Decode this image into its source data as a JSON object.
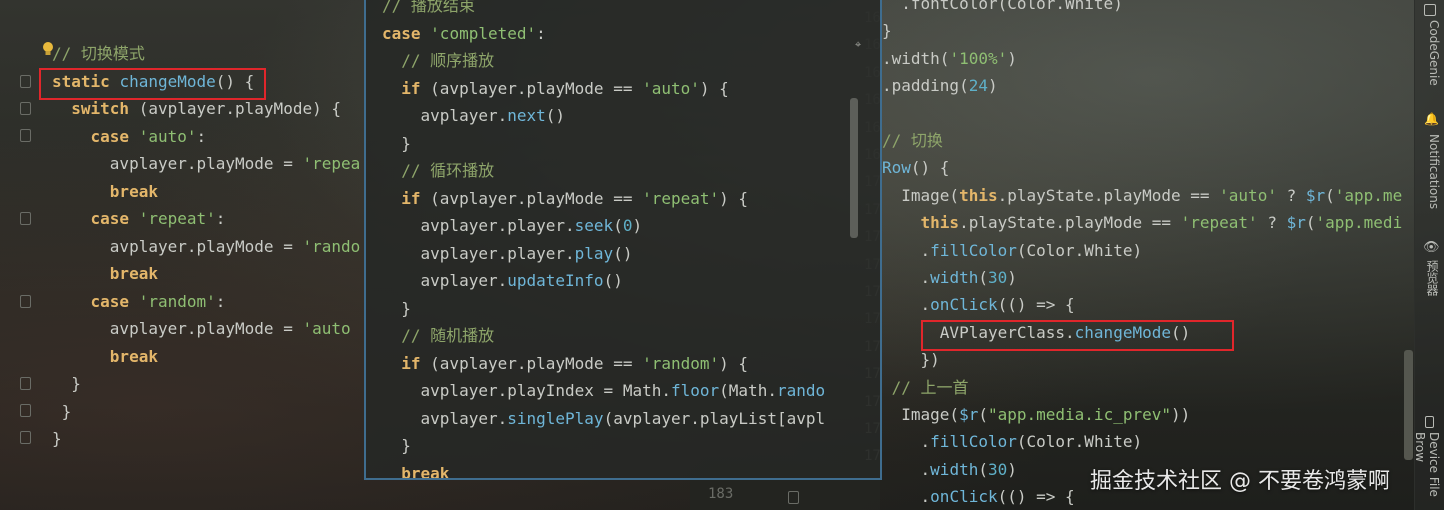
{
  "left_editor": {
    "lines": [
      {
        "segments": [
          {
            "t": "// 切换模式",
            "c": "cmt"
          }
        ]
      },
      {
        "segments": [
          {
            "t": "static",
            "c": "kw"
          },
          {
            "t": " ",
            "c": "pn"
          },
          {
            "t": "changeMode",
            "c": "fn"
          },
          {
            "t": "() {",
            "c": "pn"
          }
        ]
      },
      {
        "segments": [
          {
            "t": "  switch",
            "c": "kw"
          },
          {
            "t": " (avplayer.playMode) {",
            "c": "pn"
          }
        ]
      },
      {
        "segments": [
          {
            "t": "    case",
            "c": "kw"
          },
          {
            "t": " ",
            "c": "pn"
          },
          {
            "t": "'auto'",
            "c": "str"
          },
          {
            "t": ":",
            "c": "pn"
          }
        ]
      },
      {
        "segments": [
          {
            "t": "      avplayer.playMode = ",
            "c": "pn"
          },
          {
            "t": "'repea",
            "c": "str"
          }
        ]
      },
      {
        "segments": [
          {
            "t": "      break",
            "c": "kw"
          }
        ]
      },
      {
        "segments": [
          {
            "t": "    case",
            "c": "kw"
          },
          {
            "t": " ",
            "c": "pn"
          },
          {
            "t": "'repeat'",
            "c": "str"
          },
          {
            "t": ":",
            "c": "pn"
          }
        ]
      },
      {
        "segments": [
          {
            "t": "      avplayer.playMode = ",
            "c": "pn"
          },
          {
            "t": "'rando",
            "c": "str"
          }
        ]
      },
      {
        "segments": [
          {
            "t": "      break",
            "c": "kw"
          }
        ]
      },
      {
        "segments": [
          {
            "t": "    case",
            "c": "kw"
          },
          {
            "t": " ",
            "c": "pn"
          },
          {
            "t": "'random'",
            "c": "str"
          },
          {
            "t": ":",
            "c": "pn"
          }
        ]
      },
      {
        "segments": [
          {
            "t": "      avplayer.playMode = ",
            "c": "pn"
          },
          {
            "t": "'auto",
            "c": "str"
          }
        ]
      },
      {
        "segments": [
          {
            "t": "      break",
            "c": "kw"
          }
        ]
      },
      {
        "segments": [
          {
            "t": "  }",
            "c": "pn"
          }
        ]
      },
      {
        "segments": [
          {
            "t": " }",
            "c": "pn"
          }
        ]
      },
      {
        "segments": [
          {
            "t": "}",
            "c": "pn"
          }
        ]
      }
    ]
  },
  "popup": {
    "lines": [
      {
        "segments": [
          {
            "t": "// 播放结束",
            "c": "cmt"
          }
        ]
      },
      {
        "segments": [
          {
            "t": "case",
            "c": "kw"
          },
          {
            "t": " ",
            "c": "pn"
          },
          {
            "t": "'completed'",
            "c": "str"
          },
          {
            "t": ":",
            "c": "pn"
          }
        ]
      },
      {
        "segments": [
          {
            "t": "  // 顺序播放",
            "c": "cmt"
          }
        ]
      },
      {
        "segments": [
          {
            "t": "  if",
            "c": "kw"
          },
          {
            "t": " (avplayer.playMode == ",
            "c": "pn"
          },
          {
            "t": "'auto'",
            "c": "str"
          },
          {
            "t": ") {",
            "c": "pn"
          }
        ]
      },
      {
        "segments": [
          {
            "t": "    avplayer.",
            "c": "pn"
          },
          {
            "t": "next",
            "c": "fn"
          },
          {
            "t": "()",
            "c": "pn"
          }
        ]
      },
      {
        "segments": [
          {
            "t": "  }",
            "c": "pn"
          }
        ]
      },
      {
        "segments": [
          {
            "t": "  // 循环播放",
            "c": "cmt"
          }
        ]
      },
      {
        "segments": [
          {
            "t": "  if",
            "c": "kw"
          },
          {
            "t": " (avplayer.playMode == ",
            "c": "pn"
          },
          {
            "t": "'repeat'",
            "c": "str"
          },
          {
            "t": ") {",
            "c": "pn"
          }
        ]
      },
      {
        "segments": [
          {
            "t": "    avplayer.player.",
            "c": "pn"
          },
          {
            "t": "seek",
            "c": "fn"
          },
          {
            "t": "(",
            "c": "pn"
          },
          {
            "t": "0",
            "c": "num"
          },
          {
            "t": ")",
            "c": "pn"
          }
        ]
      },
      {
        "segments": [
          {
            "t": "    avplayer.player.",
            "c": "pn"
          },
          {
            "t": "play",
            "c": "fn"
          },
          {
            "t": "()",
            "c": "pn"
          }
        ]
      },
      {
        "segments": [
          {
            "t": "    avplayer.",
            "c": "pn"
          },
          {
            "t": "updateInfo",
            "c": "fn"
          },
          {
            "t": "()",
            "c": "pn"
          }
        ]
      },
      {
        "segments": [
          {
            "t": "  }",
            "c": "pn"
          }
        ]
      },
      {
        "segments": [
          {
            "t": "  // 随机播放",
            "c": "cmt"
          }
        ]
      },
      {
        "segments": [
          {
            "t": "  if",
            "c": "kw"
          },
          {
            "t": " (avplayer.playMode == ",
            "c": "pn"
          },
          {
            "t": "'random'",
            "c": "str"
          },
          {
            "t": ") {",
            "c": "pn"
          }
        ]
      },
      {
        "segments": [
          {
            "t": "    avplayer.playIndex = Math.",
            "c": "pn"
          },
          {
            "t": "floor",
            "c": "fn"
          },
          {
            "t": "(Math.",
            "c": "pn"
          },
          {
            "t": "rando",
            "c": "fn"
          }
        ]
      },
      {
        "segments": [
          {
            "t": "    avplayer.",
            "c": "pn"
          },
          {
            "t": "singlePlay",
            "c": "fn"
          },
          {
            "t": "(avplayer.playList[avpl",
            "c": "pn"
          }
        ]
      },
      {
        "segments": [
          {
            "t": "  }",
            "c": "pn"
          }
        ]
      },
      {
        "segments": [
          {
            "t": "  break",
            "c": "kw"
          }
        ]
      }
    ]
  },
  "right_editor": {
    "gutter": [
      "16",
      "16",
      "16",
      "16",
      "16",
      "16",
      "17",
      "17",
      "17",
      "17",
      "17",
      "17",
      "17",
      "17",
      "17",
      "17",
      "17"
    ],
    "lines": [
      {
        "segments": [
          {
            "t": "  .fontColor(Color.White)",
            "c": "pn"
          }
        ]
      },
      {
        "segments": [
          {
            "t": "}",
            "c": "pn"
          }
        ]
      },
      {
        "segments": [
          {
            "t": ".width(",
            "c": "pn"
          },
          {
            "t": "'100%'",
            "c": "str"
          },
          {
            "t": ")",
            "c": "pn"
          }
        ]
      },
      {
        "segments": [
          {
            "t": ".padding(",
            "c": "pn"
          },
          {
            "t": "24",
            "c": "num"
          },
          {
            "t": ")",
            "c": "pn"
          }
        ]
      },
      {
        "segments": [
          {
            "t": "",
            "c": "pn"
          }
        ]
      },
      {
        "segments": [
          {
            "t": "// 切换",
            "c": "cmt"
          }
        ]
      },
      {
        "segments": [
          {
            "t": "Row",
            "c": "fn"
          },
          {
            "t": "() {",
            "c": "pn"
          }
        ]
      },
      {
        "segments": [
          {
            "t": "  Image(",
            "c": "pn"
          },
          {
            "t": "this",
            "c": "thisk"
          },
          {
            "t": ".playState.playMode == ",
            "c": "pn"
          },
          {
            "t": "'auto'",
            "c": "str"
          },
          {
            "t": " ? ",
            "c": "pn"
          },
          {
            "t": "$r",
            "c": "fn"
          },
          {
            "t": "(",
            "c": "pn"
          },
          {
            "t": "'app.me",
            "c": "str"
          }
        ]
      },
      {
        "segments": [
          {
            "t": "    ",
            "c": "pn"
          },
          {
            "t": "this",
            "c": "thisk"
          },
          {
            "t": ".playState.playMode == ",
            "c": "pn"
          },
          {
            "t": "'repeat'",
            "c": "str"
          },
          {
            "t": " ? ",
            "c": "pn"
          },
          {
            "t": "$r",
            "c": "fn"
          },
          {
            "t": "(",
            "c": "pn"
          },
          {
            "t": "'app.medi",
            "c": "str"
          }
        ]
      },
      {
        "segments": [
          {
            "t": "    .",
            "c": "pn"
          },
          {
            "t": "fillColor",
            "c": "fn"
          },
          {
            "t": "(Color.White)",
            "c": "pn"
          }
        ]
      },
      {
        "segments": [
          {
            "t": "    .",
            "c": "pn"
          },
          {
            "t": "width",
            "c": "fn"
          },
          {
            "t": "(",
            "c": "pn"
          },
          {
            "t": "30",
            "c": "num"
          },
          {
            "t": ")",
            "c": "pn"
          }
        ]
      },
      {
        "segments": [
          {
            "t": "    .",
            "c": "pn"
          },
          {
            "t": "onClick",
            "c": "fn"
          },
          {
            "t": "(() => {",
            "c": "pn"
          }
        ]
      },
      {
        "segments": [
          {
            "t": "      AVPlayerClass.",
            "c": "pn"
          },
          {
            "t": "changeMode",
            "c": "fn"
          },
          {
            "t": "()",
            "c": "pn"
          }
        ]
      },
      {
        "segments": [
          {
            "t": "    })",
            "c": "pn"
          }
        ]
      },
      {
        "segments": [
          {
            "t": " // 上一首",
            "c": "cmt"
          }
        ]
      },
      {
        "segments": [
          {
            "t": "  Image(",
            "c": "pn"
          },
          {
            "t": "$r",
            "c": "fn"
          },
          {
            "t": "(",
            "c": "pn"
          },
          {
            "t": "\"app.media.ic_prev\"",
            "c": "str"
          },
          {
            "t": "))",
            "c": "pn"
          }
        ]
      },
      {
        "segments": [
          {
            "t": "    .",
            "c": "pn"
          },
          {
            "t": "fillColor",
            "c": "fn"
          },
          {
            "t": "(Color.White)",
            "c": "pn"
          }
        ]
      },
      {
        "segments": [
          {
            "t": "    .",
            "c": "pn"
          },
          {
            "t": "width",
            "c": "fn"
          },
          {
            "t": "(",
            "c": "pn"
          },
          {
            "t": "30",
            "c": "num"
          },
          {
            "t": ")",
            "c": "pn"
          }
        ]
      },
      {
        "segments": [
          {
            "t": "    .",
            "c": "pn"
          },
          {
            "t": "onClick",
            "c": "fn"
          },
          {
            "t": "(() => {",
            "c": "pn"
          }
        ]
      }
    ]
  },
  "bottom_gutter_number": "183",
  "sidebar": {
    "items": [
      {
        "label": "CodeGenie",
        "icon": "codegenie-icon"
      },
      {
        "label": "Notifications",
        "icon": "bell-icon"
      },
      {
        "label": "预览器",
        "icon": "eye-icon"
      },
      {
        "label": "Device File Brow",
        "icon": "device-icon"
      }
    ]
  },
  "watermark": "掘金技术社区 @ 不要卷鸿蒙啊"
}
